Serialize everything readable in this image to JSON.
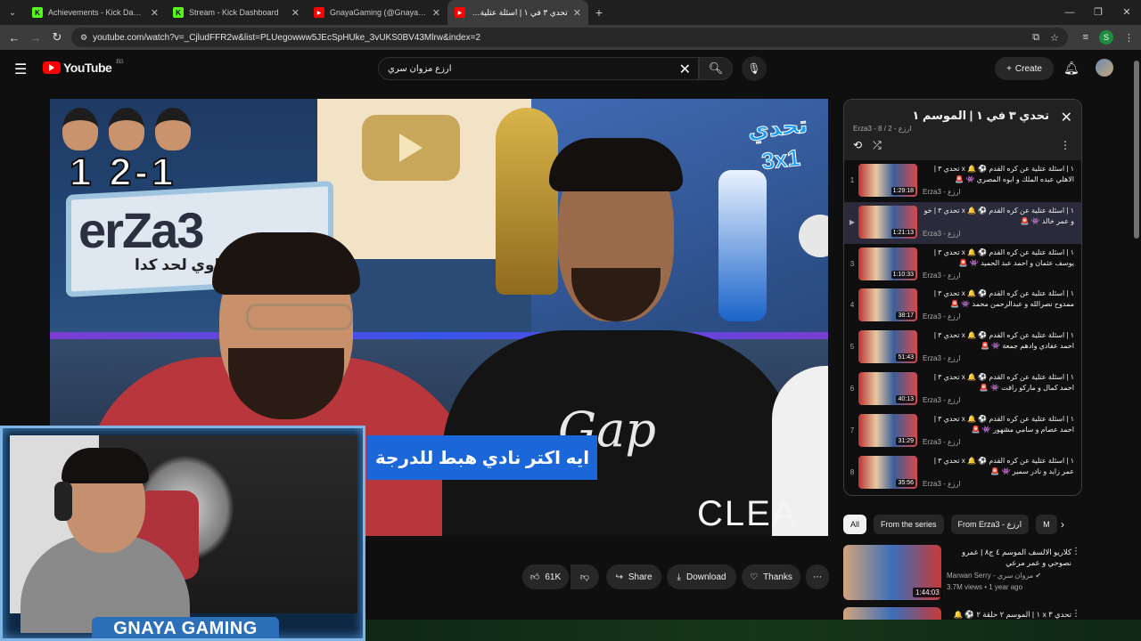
{
  "browser": {
    "tabs": [
      {
        "label": "Achievements - Kick Dashboard",
        "favicon": "K",
        "color": "#53fc18",
        "active": false
      },
      {
        "label": "Stream - Kick Dashboard",
        "favicon": "K",
        "color": "#53fc18",
        "active": false
      },
      {
        "label": "GnayaGaming (@GnayaGaming",
        "favicon": "▶",
        "color": "#ff0000",
        "active": false
      },
      {
        "label": "تحدي ٣ في ١ | اسئلة عتلية عن",
        "favicon": "▶",
        "color": "#ff0000",
        "active": true
      }
    ],
    "url": "youtube.com/watch?v=_CjludFFR2w&list=PLUegowww5JEcSpHUke_3vUKS0BV43Mlrw&index=2",
    "profile_initial": "S"
  },
  "header": {
    "logo_text": "YouTube",
    "region": "EG",
    "search_value": "ارزع مزوان سري",
    "create_label": "Create"
  },
  "player": {
    "score_text": "1 2-1",
    "banner_text": "erZa3",
    "banner_sub": "ئ اوي لحد كدا",
    "challenge_badge": "تحدي 3x1",
    "caption": "ايه اكتر نادي هبط للدرجة",
    "brand_text": "CLEA",
    "shirt_text": "Gap"
  },
  "actions": {
    "likes": "61K",
    "share": "Share",
    "download": "Download",
    "thanks": "Thanks"
  },
  "webcam": {
    "brand": "GNAYA GAMING"
  },
  "playlist": {
    "title": "تحدي ٣ في ١ | الموسم ١",
    "meta": "Erza3 - ارزع - 2 / 8",
    "items": [
      {
        "index": "1",
        "title": "١ | اسئلة عتلية عن كره القدم ⚽ 🔔 x تحدي ٣ | الاهلي عبده الملك و ابوه المصري 👾 🚨",
        "duration": "1:29:18",
        "channel": "Erza3 - ارزع"
      },
      {
        "index": "▶",
        "title": "١ | اسئلة عتلية عن كره القدم ⚽ 🔔 x تحدي ٣ | خو و عمر خالد 👾 🚨",
        "duration": "1:21:13",
        "channel": "Erza3 - ارزع"
      },
      {
        "index": "3",
        "title": "١ | اسئلة عتلية عن كره القدم ⚽ 🔔 x تحدي ٣ | يوسف عثمان و احمد عبد الحميد 👾 🚨",
        "duration": "1:10:33",
        "channel": "Erza3 - ارزع"
      },
      {
        "index": "4",
        "title": "١ | اسئلة عتلية عن كره القدم ⚽ 🔔 x تحدي ٣ | ممدوح نصرالله و عبدالرحمن محمد 👾 🚨",
        "duration": "38:17",
        "channel": "Erza3 - ارزع"
      },
      {
        "index": "5",
        "title": "١ | اسئلة عتلية عن كره القدم ⚽ 🔔 x تحدي ٣ | احمد عفادي وادهم جمعة 👾 🚨",
        "duration": "51:43",
        "channel": "Erza3 - ارزع"
      },
      {
        "index": "6",
        "title": "١ | اسئلة عتلية عن كره القدم ⚽ 🔔 x تحدي ٣ | احمد كمال و ماركو رافت 👾 🚨",
        "duration": "40:13",
        "channel": "Erza3 - ارزع"
      },
      {
        "index": "7",
        "title": "١ | اسئلة عتلية عن كره القدم ⚽ 🔔 x تحدي ٣ | احمد عصام و سامي مشهور 👾 🚨",
        "duration": "31:29",
        "channel": "Erza3 - ارزع"
      },
      {
        "index": "8",
        "title": "١ | اسئلة عتلية عن كره القدم ⚽ 🔔 x تحدي ٣ | عمر زايد و نادر سمير 👾 🚨",
        "duration": "35:56",
        "channel": "Erza3 - ارزع"
      }
    ]
  },
  "chips": [
    "All",
    "From the series",
    "From Erza3 - ارزع",
    "M"
  ],
  "recommendations": [
    {
      "title": "كلاريو الالسف الموسم ٤ ج٨ | عمرو نصوحي و عمر مرعي",
      "channel": "Marwan Serry - مروان سري ✔",
      "stats": "3.7M views • 1 year ago",
      "duration": "1:44:03"
    },
    {
      "title": "تحدي ٣ x ١ | الموسم ٢ حلقة ٢ ⚽ 🔔",
      "channel": "",
      "stats": "",
      "duration": ""
    }
  ]
}
